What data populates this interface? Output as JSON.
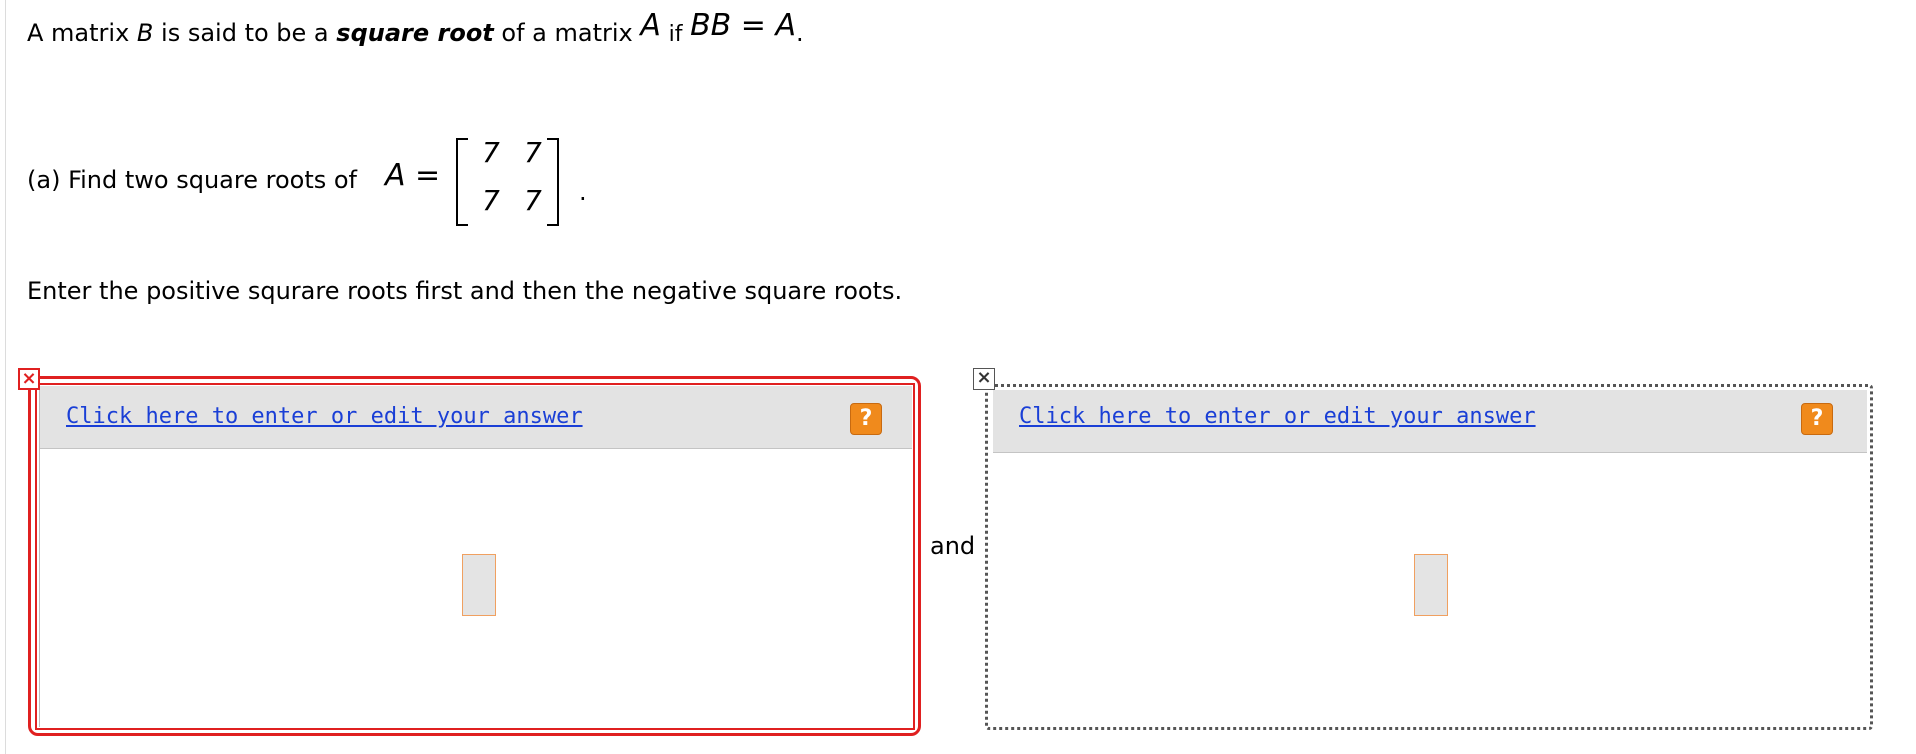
{
  "problem": {
    "intro_prefix": "A matrix",
    "intro_B": "B",
    "intro_mid": "is said to be a",
    "intro_bold": "square root",
    "intro_of": "of a matrix",
    "intro_A": "A",
    "intro_if": "if",
    "intro_eq": "BB = A",
    "intro_period": ".",
    "part_a_label": "(a) Find two square roots of",
    "matrix_lhs": "A =",
    "matrix": [
      [
        "7",
        "7"
      ],
      [
        "7",
        "7"
      ]
    ],
    "matrix_period": ".",
    "instruction": "Enter the positive squrare roots first and then the negative square roots."
  },
  "answers": {
    "left": {
      "status_icon": "×",
      "link_text": "Click here to enter or edit your answer",
      "help_icon": "?"
    },
    "connector": "and",
    "right": {
      "status_icon": "×",
      "link_text": "Click here to enter or edit your answer",
      "help_icon": "?"
    }
  },
  "colors": {
    "error_red": "#e02020",
    "link_blue": "#1a3fd6",
    "help_orange": "#f08a1c",
    "header_gray": "#e3e3e3"
  }
}
